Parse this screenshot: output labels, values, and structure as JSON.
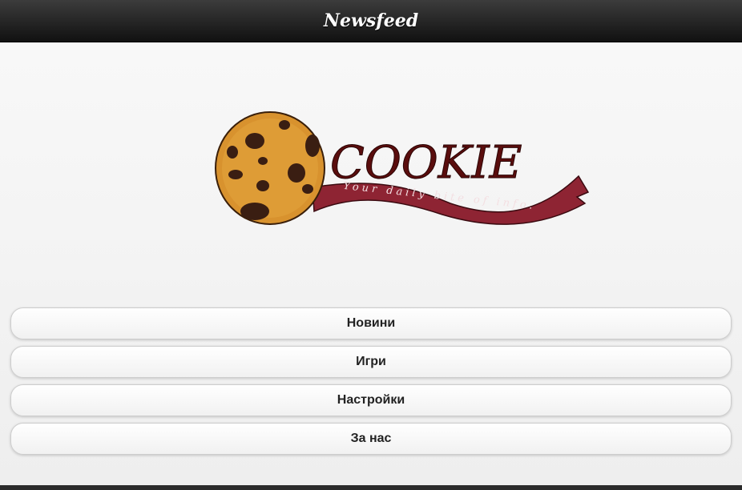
{
  "header": {
    "title": "Newsfeed"
  },
  "logo": {
    "wordmark": "COOKIE",
    "tagline": "Your daily bite of info."
  },
  "menu": {
    "items": [
      {
        "label": "Новини"
      },
      {
        "label": "Игри"
      },
      {
        "label": "Настройки"
      },
      {
        "label": "За нас"
      }
    ]
  },
  "colors": {
    "header_bg": "#1e1e1e",
    "ribbon": "#8e2433",
    "wordmark": "#5a0d0d",
    "cookie": "#d8922e"
  }
}
